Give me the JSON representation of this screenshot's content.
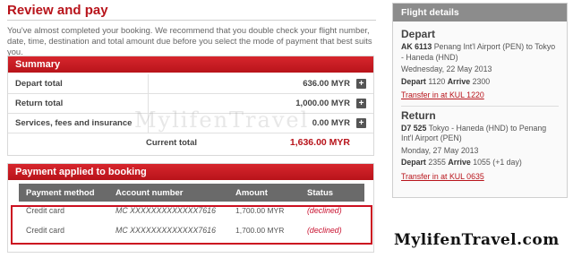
{
  "page": {
    "title": "Review and pay",
    "intro": "You've almost completed your booking. We recommend that you double check your flight number, date, time, destination and total amount due before you select the mode of payment that best suits you."
  },
  "summary": {
    "header": "Summary",
    "rows": [
      {
        "label": "Depart total",
        "value": "636.00 MYR"
      },
      {
        "label": "Return total",
        "value": "1,000.00 MYR"
      },
      {
        "label": "Services, fees and insurance",
        "value": "0.00 MYR"
      }
    ],
    "total_label": "Current total",
    "total_value": "1,636.00 MYR",
    "expand_icon": "plus-icon"
  },
  "payment": {
    "header": "Payment applied to booking",
    "columns": [
      "Payment method",
      "Account number",
      "Amount",
      "Status"
    ],
    "rows": [
      {
        "method": "Credit card",
        "account": "MC  XXXXXXXXXXXXX7616",
        "amount": "1,700.00 MYR",
        "status": "(declined)"
      },
      {
        "method": "Credit card",
        "account": "MC  XXXXXXXXXXXXX7616",
        "amount": "1,700.00 MYR",
        "status": "(declined)"
      }
    ]
  },
  "flight_details": {
    "header": "Flight details",
    "depart": {
      "title": "Depart",
      "flight_code": "AK 6113",
      "route": "Penang Int'l Airport (PEN) to Tokyo - Haneda (HND)",
      "date": "Wednesday, 22 May 2013",
      "depart_label": "Depart",
      "depart_time": "1120",
      "arrive_label": "Arrive",
      "arrive_time": "2300",
      "transfer_link": "Transfer in at KUL 1220"
    },
    "return": {
      "title": "Return",
      "flight_code": "D7 525",
      "route": "Tokyo - Haneda (HND) to Penang Int'l Airport (PEN)",
      "date": "Monday, 27 May 2013",
      "depart_label": "Depart",
      "depart_time": "2355",
      "arrive_label": "Arrive",
      "arrive_time": "1055 (+1 day)",
      "transfer_link": "Transfer in at KUL 0635"
    }
  },
  "watermark": "MylifenTravel",
  "brand": "MylifenTravel.com",
  "colors": {
    "accent": "#b8141b",
    "declined": "#c8102e",
    "table_header": "#6a6a6a",
    "sidebar_header": "#8c8c8c"
  }
}
